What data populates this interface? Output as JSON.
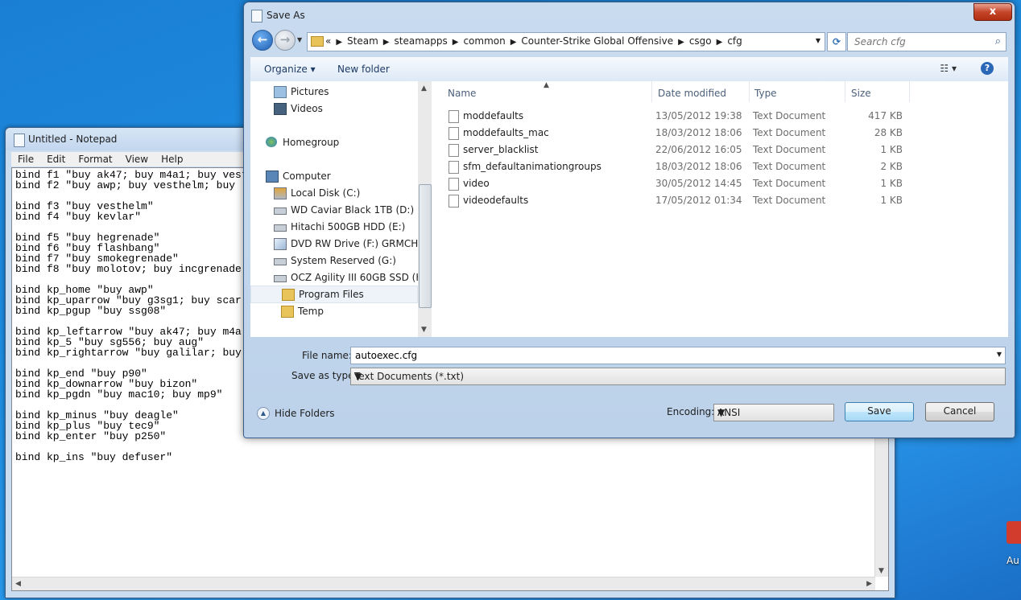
{
  "notepad": {
    "title": "Untitled - Notepad",
    "menu": [
      "File",
      "Edit",
      "Format",
      "View",
      "Help"
    ],
    "text": "bind f1 \"buy ak47; buy m4a1; buy vest\nbind f2 \"buy awp; buy vesthelm; buy\n\nbind f3 \"buy vesthelm\"\nbind f4 \"buy kevlar\"\n\nbind f5 \"buy hegrenade\"\nbind f6 \"buy flashbang\"\nbind f7 \"buy smokegrenade\"\nbind f8 \"buy molotov; buy incgrenade\n\nbind kp_home \"buy awp\"\nbind kp_uparrow \"buy g3sg1; buy scar\nbind kp_pgup \"buy ssg08\"\n\nbind kp_leftarrow \"buy ak47; buy m4a\nbind kp_5 \"buy sg556; buy aug\"\nbind kp_rightarrow \"buy galilar; buy\n\nbind kp_end \"buy p90\"\nbind kp_downarrow \"buy bizon\"\nbind kp_pgdn \"buy mac10; buy mp9\"\n\nbind kp_minus \"buy deagle\"\nbind kp_plus \"buy tec9\"\nbind kp_enter \"buy p250\"\n\nbind kp_ins \"buy defuser\""
  },
  "dialog": {
    "title": "Save As",
    "close_label": "x",
    "breadcrumbs": [
      "«",
      "Steam",
      "steamapps",
      "common",
      "Counter-Strike Global Offensive",
      "csgo",
      "cfg"
    ],
    "search_placeholder": "Search cfg",
    "toolbar": {
      "organize": "Organize ▾",
      "new_folder": "New folder"
    },
    "nav_items": [
      {
        "label": "Pictures",
        "icon": "pictures-icon",
        "indent": 1
      },
      {
        "label": "Videos",
        "icon": "videos-icon",
        "indent": 1
      },
      {
        "label": "Homegroup",
        "icon": "homegroup-icon",
        "indent": 0
      },
      {
        "label": "Computer",
        "icon": "computer-icon",
        "indent": 0
      },
      {
        "label": "Local Disk (C:)",
        "icon": "drive-icon",
        "indent": 1
      },
      {
        "label": "WD Caviar Black 1TB (D:)",
        "icon": "drive-icon",
        "indent": 1
      },
      {
        "label": "Hitachi 500GB HDD (E:)",
        "icon": "drive-icon",
        "indent": 1
      },
      {
        "label": "DVD RW Drive (F:) GRMCHPXF",
        "icon": "dvd-drive-icon",
        "indent": 1
      },
      {
        "label": "System Reserved (G:)",
        "icon": "drive-icon",
        "indent": 1
      },
      {
        "label": "OCZ Agility III 60GB SSD (H:)",
        "icon": "drive-icon",
        "indent": 1
      },
      {
        "label": "Program Files",
        "icon": "folder-icon",
        "indent": 2
      },
      {
        "label": "Temp",
        "icon": "folder-icon",
        "indent": 2
      }
    ],
    "columns": [
      "Name",
      "Date modified",
      "Type",
      "Size"
    ],
    "files": [
      {
        "name": "moddefaults",
        "date": "13/05/2012 19:38",
        "type": "Text Document",
        "size": "417 KB"
      },
      {
        "name": "moddefaults_mac",
        "date": "18/03/2012 18:06",
        "type": "Text Document",
        "size": "28 KB"
      },
      {
        "name": "server_blacklist",
        "date": "22/06/2012 16:05",
        "type": "Text Document",
        "size": "1 KB"
      },
      {
        "name": "sfm_defaultanimationgroups",
        "date": "18/03/2012 18:06",
        "type": "Text Document",
        "size": "2 KB"
      },
      {
        "name": "video",
        "date": "30/05/2012 14:45",
        "type": "Text Document",
        "size": "1 KB"
      },
      {
        "name": "videodefaults",
        "date": "17/05/2012 01:34",
        "type": "Text Document",
        "size": "1 KB"
      }
    ],
    "file_name_label": "File name:",
    "file_name_value": "autoexec.cfg",
    "save_type_label": "Save as type:",
    "save_type_value": "Text Documents (*.txt)",
    "hide_folders": "Hide Folders",
    "encoding_label": "Encoding:",
    "encoding_value": "ANSI",
    "save_button": "Save",
    "cancel_button": "Cancel"
  },
  "desktop": {
    "partial_icon_label": "Au"
  }
}
